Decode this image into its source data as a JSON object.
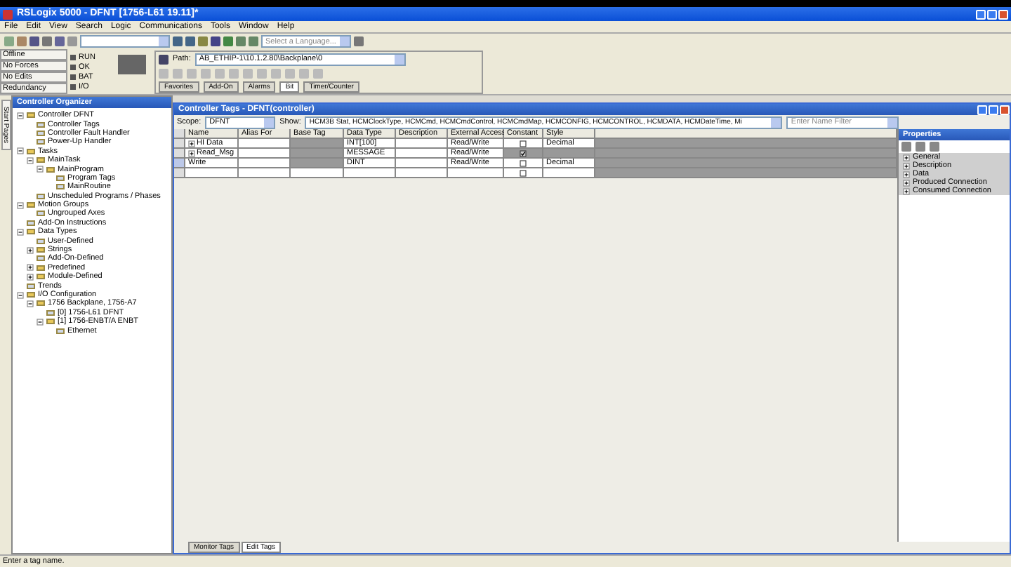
{
  "window": {
    "title": "RSLogix 5000 - DFNT [1756-L61 19.11]*"
  },
  "menu": [
    "File",
    "Edit",
    "View",
    "Search",
    "Logic",
    "Communications",
    "Tools",
    "Window",
    "Help"
  ],
  "toolbar": {
    "language": {
      "placeholder": "Select a Language..."
    },
    "path_label": "Path:",
    "path": "AB_ETHIP-1\\10.1.2.80\\Backplane\\0"
  },
  "status_pane": {
    "modes": [
      "Offline",
      "No Forces",
      "No Edits",
      "Redundancy"
    ],
    "indicators": [
      "RUN",
      "OK",
      "BAT",
      "I/O"
    ]
  },
  "instruction_tabs": [
    {
      "label": "Favorites",
      "selected": false
    },
    {
      "label": "Add-On",
      "selected": false
    },
    {
      "label": "Alarms",
      "selected": false
    },
    {
      "label": "Bit",
      "selected": true
    },
    {
      "label": "Timer/Counter",
      "selected": false
    }
  ],
  "side_tab": "Start Pages",
  "organizer": {
    "title": "Controller Organizer",
    "tree": [
      {
        "label": "Controller DFNT",
        "expanded": true,
        "children": [
          {
            "label": "Controller Tags"
          },
          {
            "label": "Controller Fault Handler"
          },
          {
            "label": "Power-Up Handler"
          }
        ]
      },
      {
        "label": "Tasks",
        "expanded": true,
        "children": [
          {
            "label": "MainTask",
            "expanded": true,
            "children": [
              {
                "label": "MainProgram",
                "expanded": true,
                "children": [
                  {
                    "label": "Program Tags"
                  },
                  {
                    "label": "MainRoutine"
                  }
                ]
              }
            ]
          },
          {
            "label": "Unscheduled Programs / Phases"
          }
        ]
      },
      {
        "label": "Motion Groups",
        "expanded": true,
        "children": [
          {
            "label": "Ungrouped Axes"
          }
        ]
      },
      {
        "label": "Add-On Instructions"
      },
      {
        "label": "Data Types",
        "expanded": true,
        "children": [
          {
            "label": "User-Defined"
          },
          {
            "label": "Strings",
            "expanded": false
          },
          {
            "label": "Add-On-Defined"
          },
          {
            "label": "Predefined",
            "expanded": false
          },
          {
            "label": "Module-Defined",
            "expanded": false
          }
        ]
      },
      {
        "label": "Trends"
      },
      {
        "label": "I/O Configuration",
        "expanded": true,
        "children": [
          {
            "label": "1756 Backplane, 1756-A7",
            "expanded": true,
            "children": [
              {
                "label": "[0] 1756-L61 DFNT"
              },
              {
                "label": "[1] 1756-ENBT/A ENBT",
                "expanded": true,
                "children": [
                  {
                    "label": "Ethernet"
                  }
                ]
              }
            ]
          }
        ]
      }
    ]
  },
  "tags_window": {
    "title": "Controller Tags - DFNT(controller)",
    "scope_label": "Scope:",
    "scope": "DFNT",
    "show_label": "Show:",
    "show": "HCM3B Stat, HCMClockType, HCMCmd, HCMCmdControl, HCMCmdMap, HCMCONFIG, HCMCONTROL, HCMDATA, HCMDateTime, Mi",
    "filter": {
      "placeholder": "Enter Name Filter"
    },
    "columns": [
      "Name",
      "Alias For",
      "Base Tag",
      "Data Type",
      "Description",
      "External Access",
      "Constant",
      "Style"
    ],
    "rows": [
      {
        "name": "HI Data",
        "expandable": true,
        "data_type": "INT[100]",
        "external_access": "Read/Write",
        "constant": false,
        "style": "Decimal",
        "selected": false
      },
      {
        "name": "Read_Msg",
        "expandable": true,
        "data_type": "MESSAGE",
        "external_access": "Read/Write",
        "constant": true,
        "style": "",
        "selected": false
      },
      {
        "name": "Write",
        "expandable": false,
        "data_type": "DINT",
        "external_access": "Read/Write",
        "constant": false,
        "style": "Decimal",
        "selected": true
      }
    ],
    "new_row": {
      "constant": false
    }
  },
  "properties": {
    "title": "Properties",
    "sections": [
      "General",
      "Description",
      "Data",
      "Produced Connection",
      "Consumed Connection"
    ]
  },
  "bottom_tabs": [
    {
      "label": "Monitor Tags",
      "selected": false
    },
    {
      "label": "Edit Tags",
      "selected": true
    }
  ],
  "status_bar": "Enter a tag name."
}
